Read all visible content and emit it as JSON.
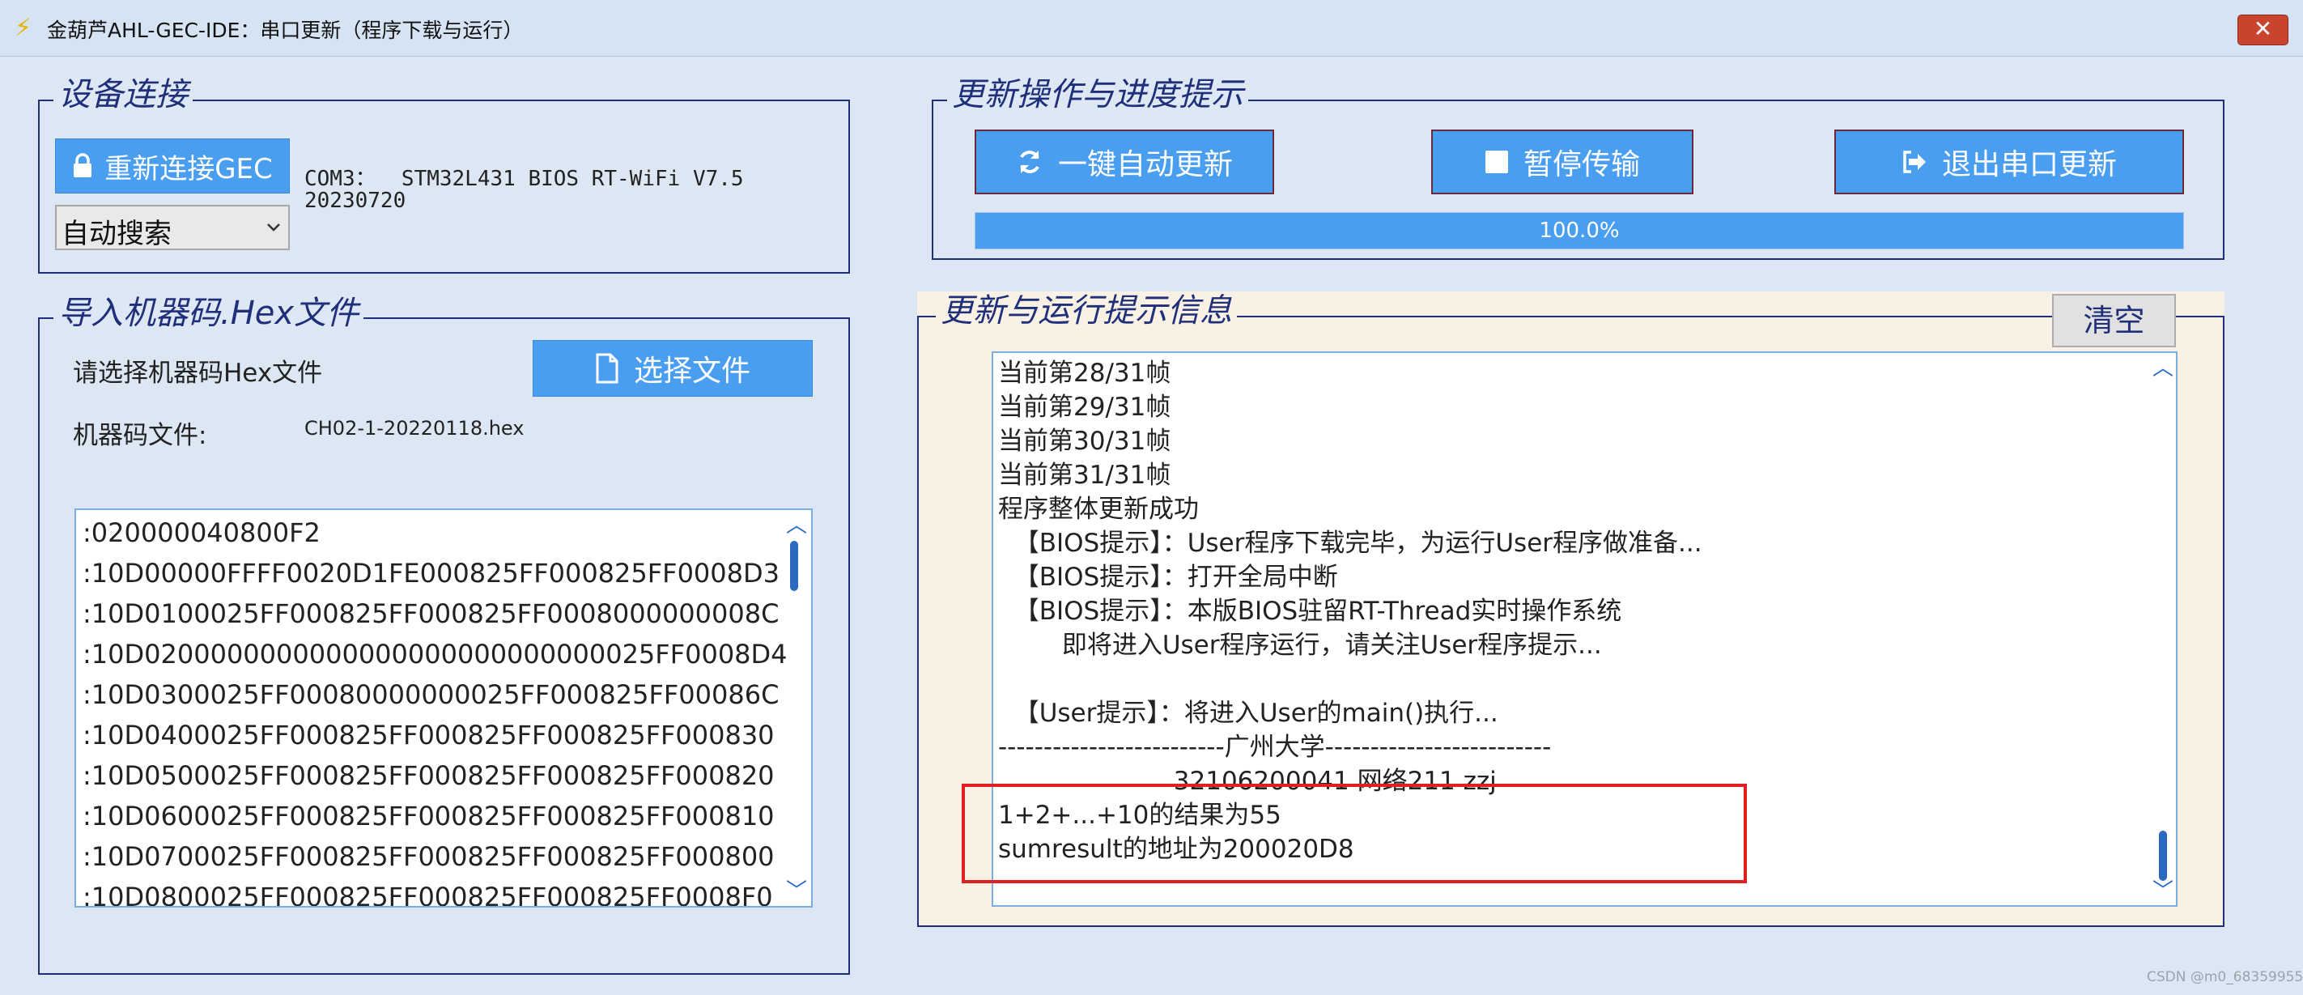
{
  "window": {
    "title": "金葫芦AHL-GEC-IDE：串口更新（程序下载与运行）",
    "app_icon": "lightning-icon",
    "close_label": "✕"
  },
  "device_panel": {
    "legend": "设备连接",
    "reconnect_label": "重新连接GEC",
    "port_info_line1": "COM3：  STM32L431 BIOS RT-WiFi V7.5",
    "port_info_line2": "20230720",
    "search_mode": "自动搜索"
  },
  "update_panel": {
    "legend": "更新操作与进度提示",
    "auto_update_label": "一键自动更新",
    "pause_label": "暂停传输",
    "exit_label": "退出串口更新",
    "progress_text": "100.0%",
    "progress_value": 1.0
  },
  "import_panel": {
    "legend": "导入机器码.Hex文件",
    "prompt": "请选择机器码Hex文件",
    "choose_file_label": "选择文件",
    "file_label": "机器码文件:",
    "file_name": "CH02-1-20220118.hex",
    "hex_lines": [
      ":020000040800F2",
      ":10D00000FFFF0020D1FE000825FF000825FF0008D3",
      ":10D0100025FF000825FF000825FF0008000000008C",
      ":10D0200000000000000000000000000025FF0008D4",
      ":10D0300025FF00080000000025FF000825FF00086C",
      ":10D0400025FF000825FF000825FF000825FF000830",
      ":10D0500025FF000825FF000825FF000825FF000820",
      ":10D0600025FF000825FF000825FF000825FF000810",
      ":10D0700025FF000825FF000825FF000825FF000800",
      ":10D0800025FF000825FF000825FF000825FF0008F0"
    ]
  },
  "log_panel": {
    "legend": "更新与运行提示信息",
    "clear_label": "清空",
    "lines": [
      "当前第28/31帧",
      "当前第29/31帧",
      "当前第30/31帧",
      "当前第31/31帧",
      "程序整体更新成功",
      "  【BIOS提示】：User程序下载完毕，为运行User程序做准备...",
      "  【BIOS提示】：打开全局中断",
      "  【BIOS提示】：本版BIOS驻留RT-Thread实时操作系统",
      "        即将进入User程序运行，请关注User程序提示...",
      "",
      "  【User提示】：将进入User的main()执行...",
      "-------------------------广州大学-------------------------",
      "                      32106200041 网络211 zzj",
      "1+2+...+10的结果为55",
      "sumresult的地址为200020D8"
    ],
    "highlight_color": "#e02020"
  },
  "watermark": "CSDN @m0_68359955"
}
